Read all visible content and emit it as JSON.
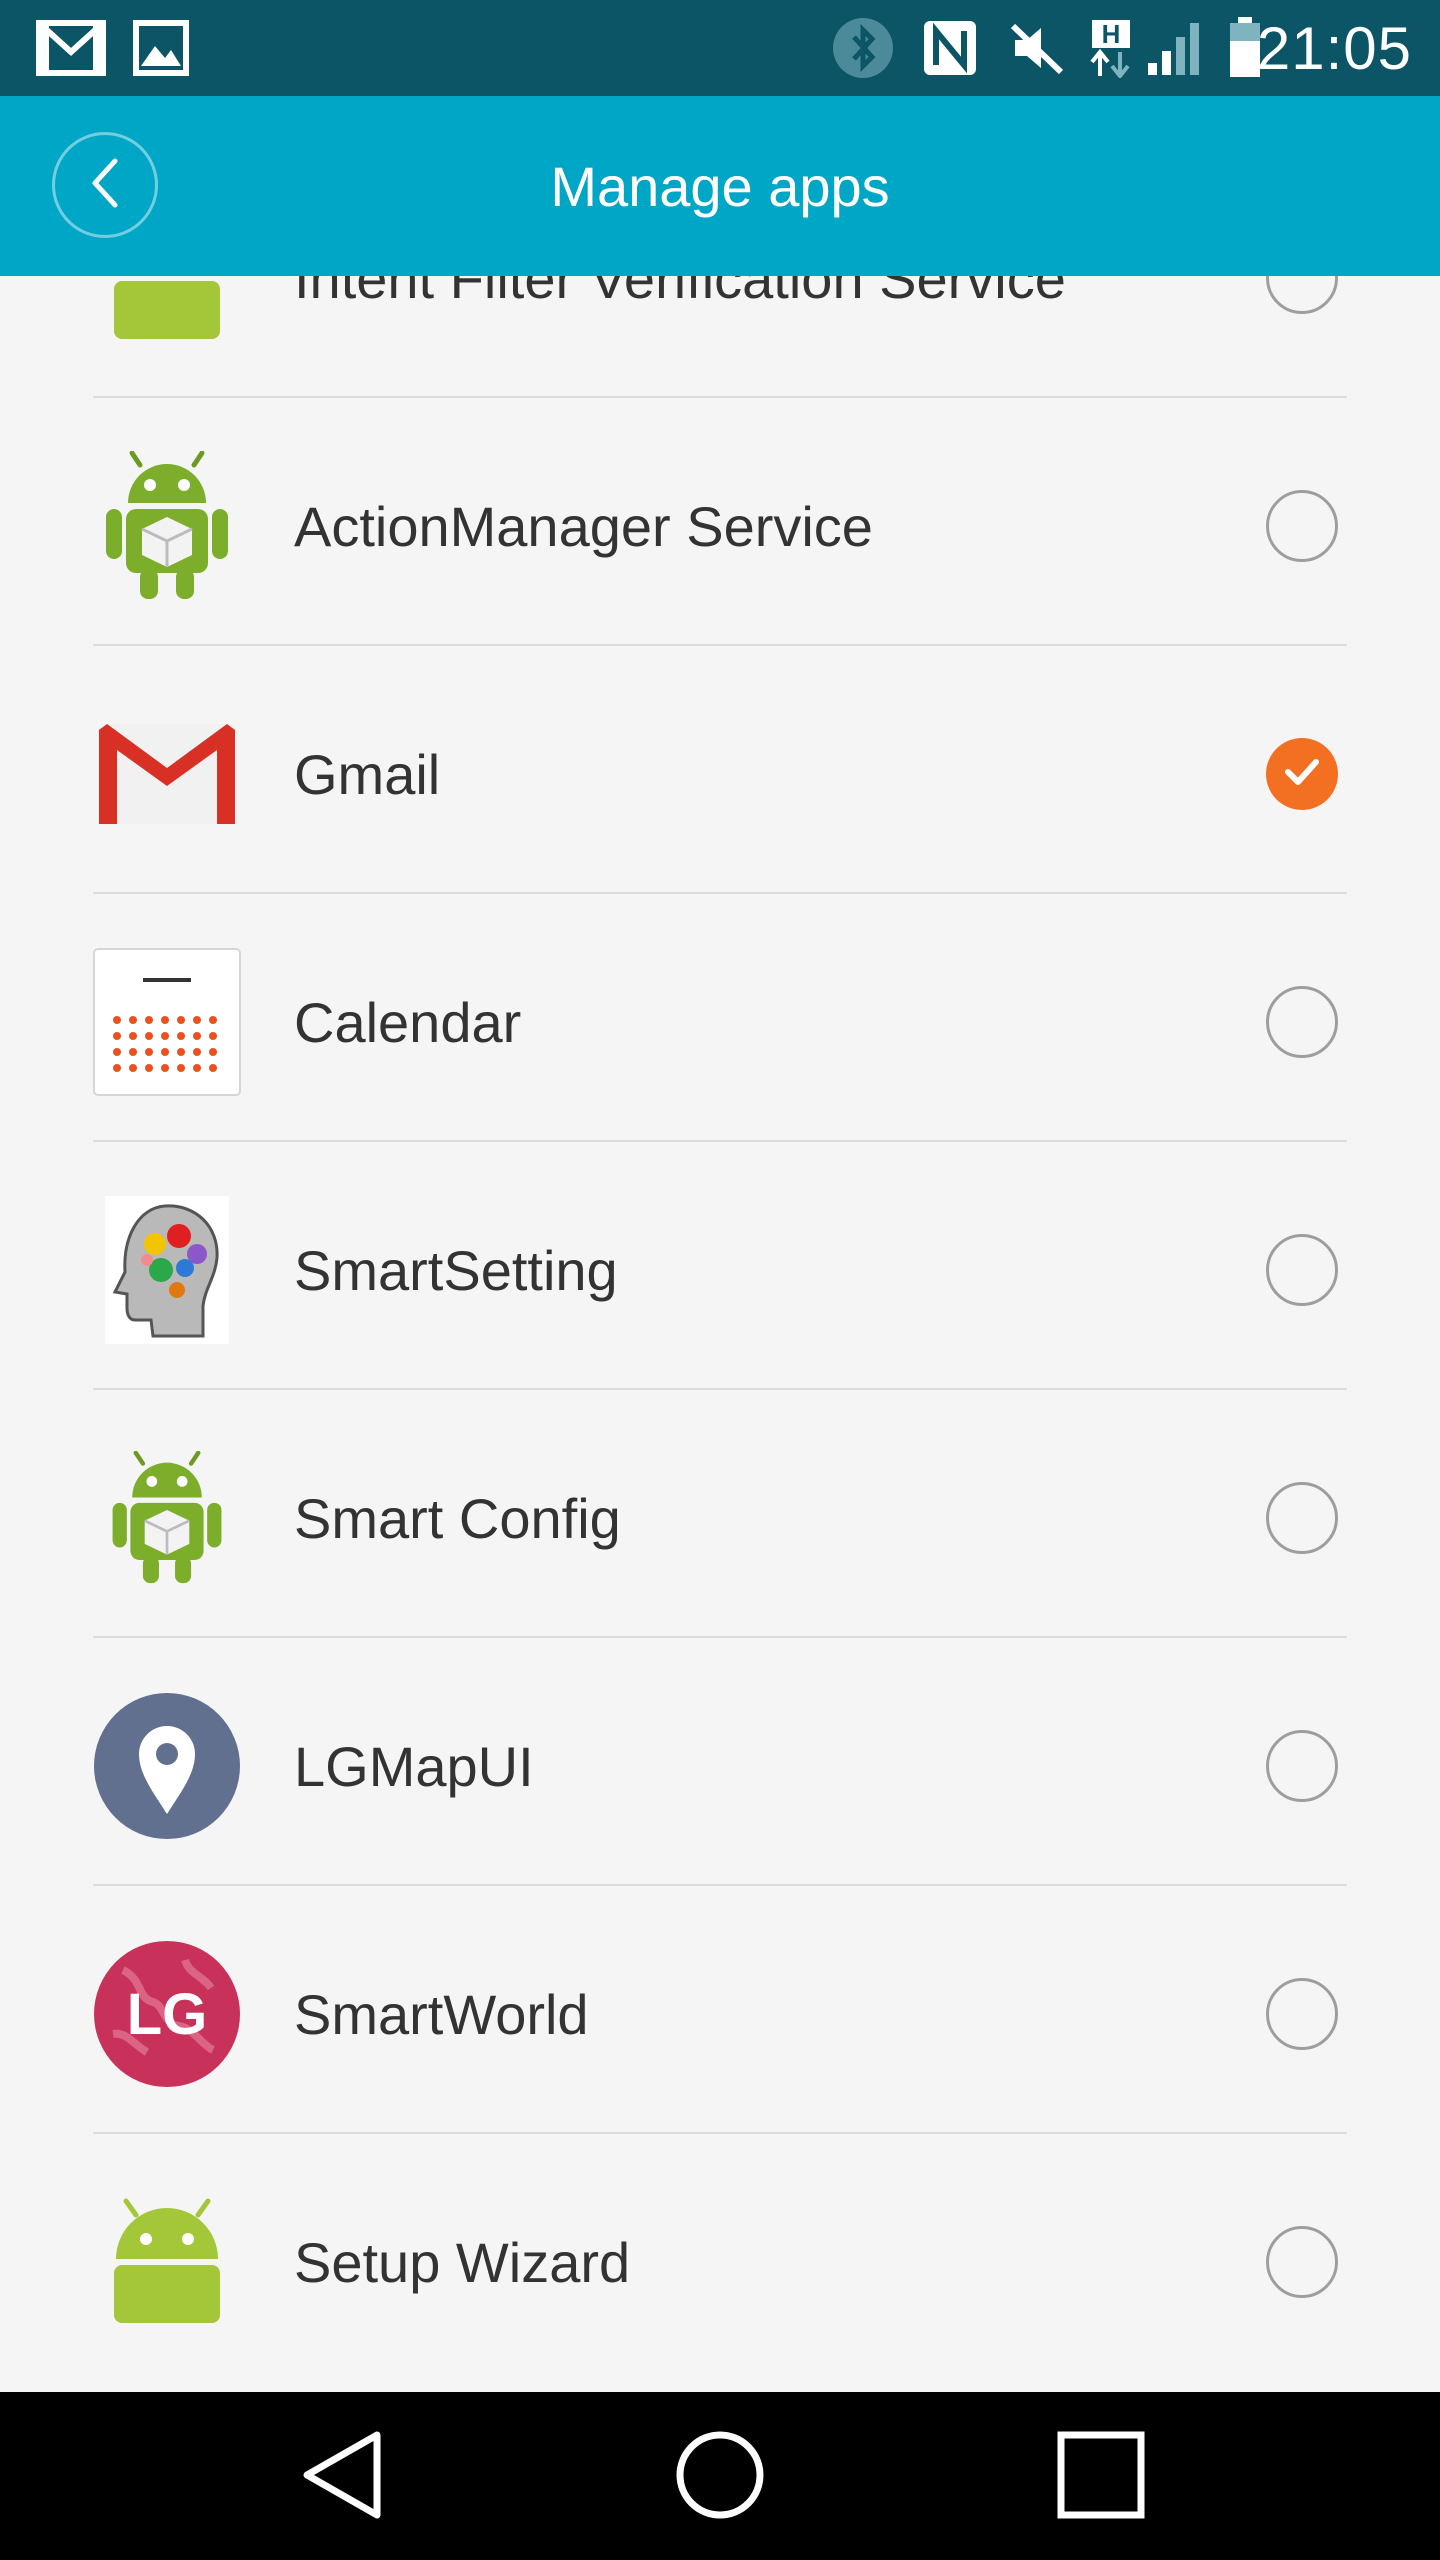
{
  "status_bar": {
    "time": "21:05",
    "icons": [
      "gmail-notification-icon",
      "image-notification-icon",
      "bluetooth-icon",
      "nfc-icon",
      "mute-icon",
      "h-data-icon",
      "signal-icon",
      "battery-icon"
    ]
  },
  "app_bar": {
    "title": "Manage apps"
  },
  "apps": [
    {
      "label": "Intent Filter Verification Service",
      "icon": "android-icon",
      "checked": false
    },
    {
      "label": "ActionManager Service",
      "icon": "android-package-icon",
      "checked": false
    },
    {
      "label": "Gmail",
      "icon": "gmail-icon",
      "checked": true
    },
    {
      "label": "Calendar",
      "icon": "calendar-icon",
      "checked": false
    },
    {
      "label": "SmartSetting",
      "icon": "smartsetting-icon",
      "checked": false
    },
    {
      "label": "Smart Config",
      "icon": "android-package-icon",
      "checked": false
    },
    {
      "label": "LGMapUI",
      "icon": "map-pin-icon",
      "checked": false
    },
    {
      "label": "SmartWorld",
      "icon": "lg-icon",
      "checked": false,
      "logo_text": "LG"
    },
    {
      "label": "Setup Wizard",
      "icon": "android-icon",
      "checked": false
    }
  ],
  "colors": {
    "status_bar": "#0b5566",
    "app_bar": "#00a6c6",
    "checked_radio": "#f36f21",
    "android_green": "#a4c639"
  },
  "nav_bar": {
    "buttons": [
      "back-nav-icon",
      "home-nav-icon",
      "recents-nav-icon"
    ]
  }
}
